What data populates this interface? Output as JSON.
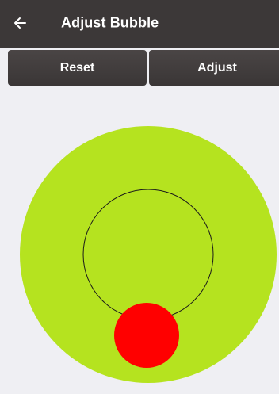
{
  "app_bar": {
    "back_icon": "arrow-left-icon",
    "title": "Adjust Bubble"
  },
  "toolbar": {
    "reset_label": "Reset",
    "adjust_label": "Adjust"
  },
  "colors": {
    "app_bar": "#3c3838",
    "background": "#efeff3",
    "level_disc": "#b5e31f",
    "target_ring": "#1a1a1a",
    "bubble": "#ff0000"
  }
}
